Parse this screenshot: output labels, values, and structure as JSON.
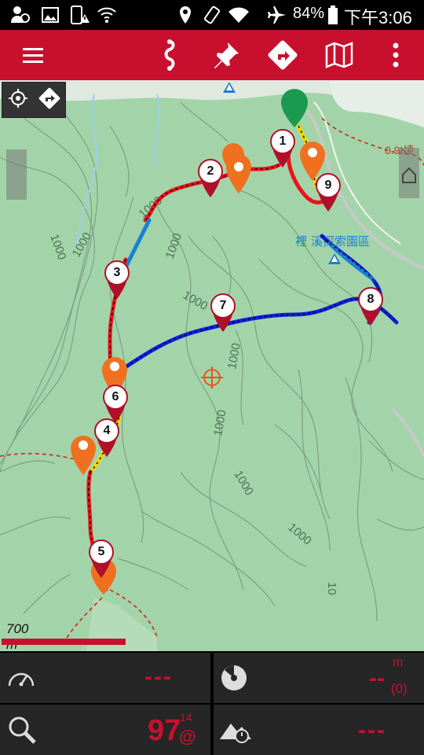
{
  "status_bar": {
    "battery_percent": "84%",
    "time": "下午3:06",
    "icons": [
      "accessibility-icon",
      "image-icon",
      "phone-alert-icon",
      "wifi-signal-icon",
      "location-icon",
      "rotate-icon",
      "wifi-icon",
      "airplane-icon",
      "battery-icon"
    ]
  },
  "toolbar": {
    "buttons": [
      "menu-icon",
      "route-icon",
      "pin-icon",
      "directions-icon",
      "map-icon",
      "more-vert-icon"
    ]
  },
  "map": {
    "contour_labels": [
      "1000",
      "1000",
      "1000",
      "1000",
      "1000",
      "1000",
      "1000",
      "1000",
      "1000",
      "10"
    ],
    "place_label": "裡",
    "place_label2": "溪探索園區",
    "distance_label": "0.9K",
    "distance_label2": "凌",
    "waypoints": [
      {
        "label": "1"
      },
      {
        "label": "2"
      },
      {
        "label": "3"
      },
      {
        "label": "4"
      },
      {
        "label": "5"
      },
      {
        "label": "6"
      },
      {
        "label": "7"
      },
      {
        "label": "8"
      },
      {
        "label": "9"
      }
    ],
    "scale_text": "700 m",
    "colors": {
      "track_red": "#e8141c",
      "track_blue": "#1020e0",
      "track_yellow": "#f5d800",
      "marker_red": "#b0102a",
      "marker_orange": "#f07020",
      "start_green": "#1a9a50"
    }
  },
  "dashboard": {
    "speed_value": "---",
    "distance_value": "--",
    "distance_unit": "m",
    "distance_sub": "(0)",
    "accuracy_value": "97",
    "accuracy_super": "14",
    "accuracy_suffix": "@",
    "elevation_value": "---"
  }
}
